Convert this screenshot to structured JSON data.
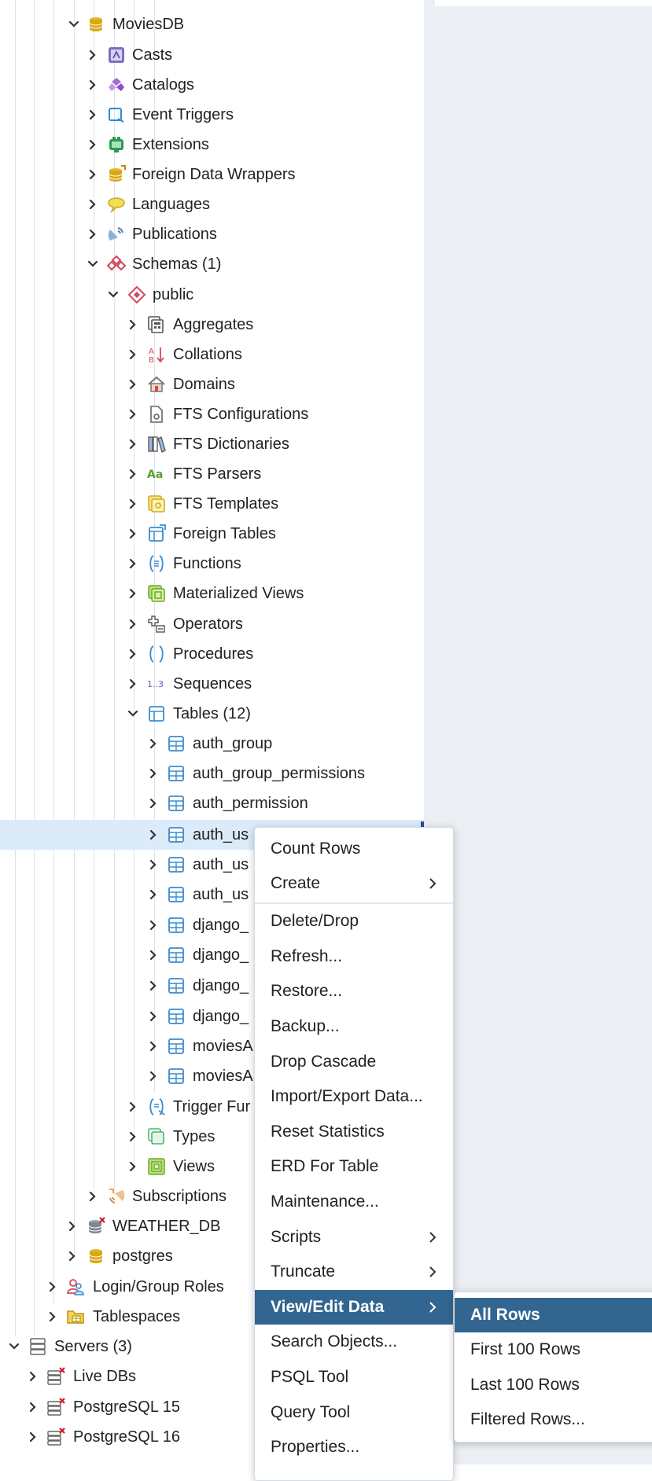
{
  "tree": {
    "moviesdb": "MoviesDB",
    "casts": "Casts",
    "catalogs": "Catalogs",
    "event_triggers": "Event Triggers",
    "extensions": "Extensions",
    "foreign_data_wrappers": "Foreign Data Wrappers",
    "languages": "Languages",
    "publications": "Publications",
    "schemas": "Schemas (1)",
    "public": "public",
    "aggregates": "Aggregates",
    "collations": "Collations",
    "domains": "Domains",
    "fts_configurations": "FTS Configurations",
    "fts_dictionaries": "FTS Dictionaries",
    "fts_parsers": "FTS Parsers",
    "fts_templates": "FTS Templates",
    "foreign_tables": "Foreign Tables",
    "functions": "Functions",
    "materialized_views": "Materialized Views",
    "operators": "Operators",
    "procedures": "Procedures",
    "sequences": "Sequences",
    "tables": "Tables (12)",
    "table_items": [
      "auth_group",
      "auth_group_permissions",
      "auth_permission",
      "auth_us",
      "auth_us",
      "auth_us",
      "django_",
      "django_",
      "django_",
      "django_",
      "moviesA",
      "moviesA"
    ],
    "trigger_functions": "Trigger Fur",
    "types": "Types",
    "views": "Views",
    "subscriptions": "Subscriptions",
    "weather_db": "WEATHER_DB",
    "postgres": "postgres",
    "login_group_roles": "Login/Group Roles",
    "tablespaces": "Tablespaces",
    "servers": "Servers (3)",
    "live_dbs": "Live DBs",
    "postgresql15": "PostgreSQL 15",
    "postgresql16": "PostgreSQL 16"
  },
  "context_menu": {
    "count_rows": "Count Rows",
    "create": "Create",
    "delete_drop": "Delete/Drop",
    "refresh": "Refresh...",
    "restore": "Restore...",
    "backup": "Backup...",
    "drop_cascade": "Drop Cascade",
    "import_export": "Import/Export Data...",
    "reset_statistics": "Reset Statistics",
    "erd_for_table": "ERD For Table",
    "maintenance": "Maintenance...",
    "scripts": "Scripts",
    "truncate": "Truncate",
    "view_edit_data": "View/Edit Data",
    "search_objects": "Search Objects...",
    "psql_tool": "PSQL Tool",
    "query_tool": "Query Tool",
    "properties": "Properties..."
  },
  "submenu": {
    "all_rows": "All Rows",
    "first_100": "First 100 Rows",
    "last_100": "Last 100 Rows",
    "filtered_rows": "Filtered Rows..."
  },
  "colors": {
    "accent": "#326690",
    "selection": "#dbebfa",
    "panel_bg": "#ebeef3"
  },
  "icons": {
    "chevron_right": "chevron-right-icon",
    "chevron_down": "chevron-down-icon",
    "database": "database-icon",
    "table": "table-icon"
  }
}
